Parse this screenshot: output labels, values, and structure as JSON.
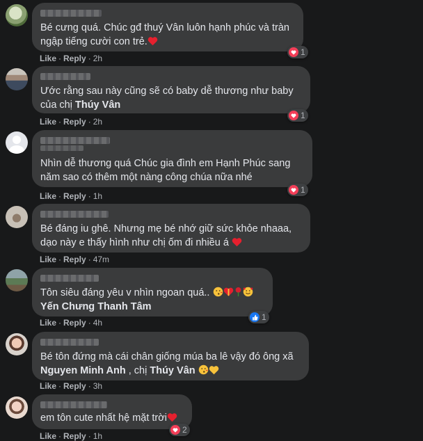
{
  "comments": [
    {
      "text_1": "Bé cưng quá. Chúc gđ thuý Vân luôn hạnh phúc và tràn",
      "text_2": "ngập tiếng cười con trẻ.",
      "like": "Like",
      "reply": "Reply",
      "time": "2h",
      "reaction_icon": "heart",
      "reaction_count": "1"
    },
    {
      "text_1": "Ước rằng sau này cũng sẽ có baby dễ thương như baby",
      "text_2a": "của chị ",
      "tag": "Thúy Vân",
      "like": "Like",
      "reply": "Reply",
      "time": "2h",
      "reaction_icon": "heart",
      "reaction_count": "1"
    },
    {
      "text_1": "Nhìn dễ thương quá Chúc gia đình em Hạnh Phúc sang",
      "text_2": "năm sao có thêm một nàng công chúa nữa nhé",
      "like": "Like",
      "reply": "Reply",
      "time": "1h",
      "reaction_icon": "heart",
      "reaction_count": "1"
    },
    {
      "text_1": "Bé đáng iu ghê. Nhưng mẹ bé nhớ giữ sức khỏe nhaaa,",
      "text_2": "dạo này e thấy hình như chị ốm đi nhiều á",
      "like": "Like",
      "reply": "Reply",
      "time": "47m"
    },
    {
      "text_1": "Tôn siêu đáng yêu v nhìn ngoan quá..",
      "tag": "Yến Chưng Thanh Tâm",
      "like": "Like",
      "reply": "Reply",
      "time": "4h",
      "reaction_icon": "like",
      "reaction_count": "1"
    },
    {
      "text_1": "Bé tôn đứng mà cái chân giống múa ba lê vậy đó ông xã",
      "tag_1": "Nguyen Minh Anh",
      "sep": " , chị ",
      "tag_2": "Thúy Vân",
      "like": "Like",
      "reply": "Reply",
      "time": "3h"
    },
    {
      "text_1": "em tôn cute nhất hệ mặt trời",
      "like": "Like",
      "reply": "Reply",
      "time": "1h",
      "reaction_icon": "heart",
      "reaction_count": "2"
    }
  ],
  "colors": {
    "background": "#18191a",
    "bubble": "#3a3b3c",
    "text": "#e4e6eb",
    "meta": "#b0b3b8",
    "heart": "#f33e58",
    "like": "#1877f2"
  }
}
